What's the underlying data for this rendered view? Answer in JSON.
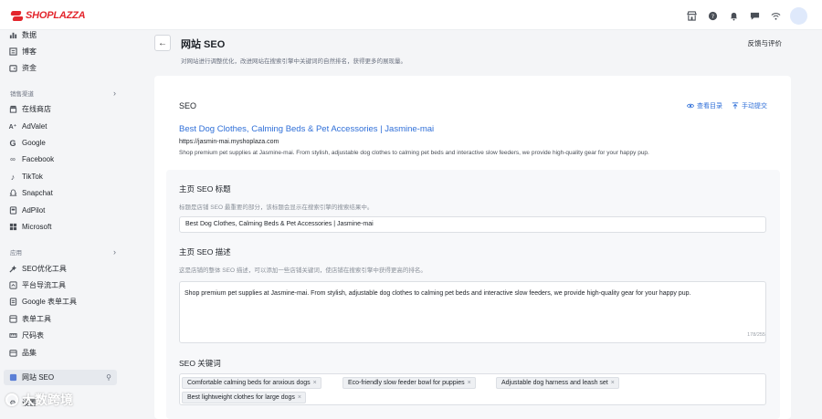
{
  "brand": {
    "name": "SHOPLAZZA",
    "color": "#e3262d"
  },
  "topbar": {
    "icons": [
      "store-icon",
      "help-icon",
      "notification-icon",
      "message-icon",
      "wifi-icon"
    ]
  },
  "sidebar": {
    "items_top": [
      {
        "label": "数据",
        "icon": "chart-icon"
      },
      {
        "label": "博客",
        "icon": "blog-icon"
      },
      {
        "label": "资金",
        "icon": "wallet-icon"
      }
    ],
    "section_sales": "销售渠道",
    "sales_items": [
      {
        "label": "在线商店",
        "icon": "store-icon"
      },
      {
        "label": "AdValet",
        "icon": "advalet-icon"
      },
      {
        "label": "Google",
        "icon": "google-icon"
      },
      {
        "label": "Facebook",
        "icon": "facebook-icon"
      },
      {
        "label": "TikTok",
        "icon": "tiktok-icon"
      },
      {
        "label": "Snapchat",
        "icon": "snapchat-icon"
      },
      {
        "label": "AdPilot",
        "icon": "adpilot-icon"
      },
      {
        "label": "Microsoft",
        "icon": "microsoft-icon"
      }
    ],
    "section_apps": "应用",
    "app_items": [
      {
        "label": "SEO优化工具",
        "icon": "seo-tool-icon"
      },
      {
        "label": "平台导流工具",
        "icon": "traffic-icon"
      },
      {
        "label": "Google 表单工具",
        "icon": "form-icon"
      },
      {
        "label": "表单工具",
        "icon": "form2-icon"
      },
      {
        "label": "尺码表",
        "icon": "ruler-icon"
      },
      {
        "label": "品集",
        "icon": "collection-icon"
      }
    ],
    "active_item": {
      "label": "网站 SEO",
      "icon": "seo-icon"
    },
    "bottom_item": "设置"
  },
  "header": {
    "title": "网站 SEO",
    "subtitle": "对网站进行调整优化，改进网站在搜索引擎中关键词的自然排名，获得更多的展现量。",
    "feedback": "反馈与评价"
  },
  "seo": {
    "heading": "SEO",
    "view_index": "查看目录",
    "manual_submit": "手动提交",
    "preview_title": "Best Dog Clothes, Calming Beds & Pet Accessories | Jasmine-mai",
    "preview_url": "https://jasmin-mai.myshoplaza.com",
    "preview_desc": "Shop premium pet supplies at Jasmine-mai. From stylish, adjustable dog clothes to calming pet beds and interactive slow feeders, we provide high-quality gear for your happy pup."
  },
  "form": {
    "title_label": "主页 SEO 标题",
    "title_help": "标题是店铺 SEO 最重要的部分，该标题会显示在搜索引擎的搜索结果中。",
    "title_value": "Best Dog Clothes, Calming Beds & Pet Accessories | Jasmine-mai",
    "desc_label": "主页 SEO 描述",
    "desc_help": "这是店铺的整体 SEO 描述，可以添加一些店铺关键词，使店铺在搜索引擎中获得更高的排名。",
    "desc_value": "Shop premium pet supplies at Jasmine-mai. From stylish, adjustable dog clothes to calming pet beds and interactive slow feeders, we provide high-quality gear for your happy pup.",
    "desc_counter": "178/255",
    "keywords_label": "SEO 关键词",
    "keywords": [
      "Comfortable calming beds for anxious dogs",
      "Eco-friendly slow feeder bowl for puppies",
      "Adjustable dog harness and leash set",
      "Best lightweight clothes for large dogs"
    ]
  },
  "watermark": "大数跨境",
  "colors": {
    "link": "#2f6fd8",
    "page_bg": "#f4f5f7",
    "card_bg": "#ffffff"
  }
}
